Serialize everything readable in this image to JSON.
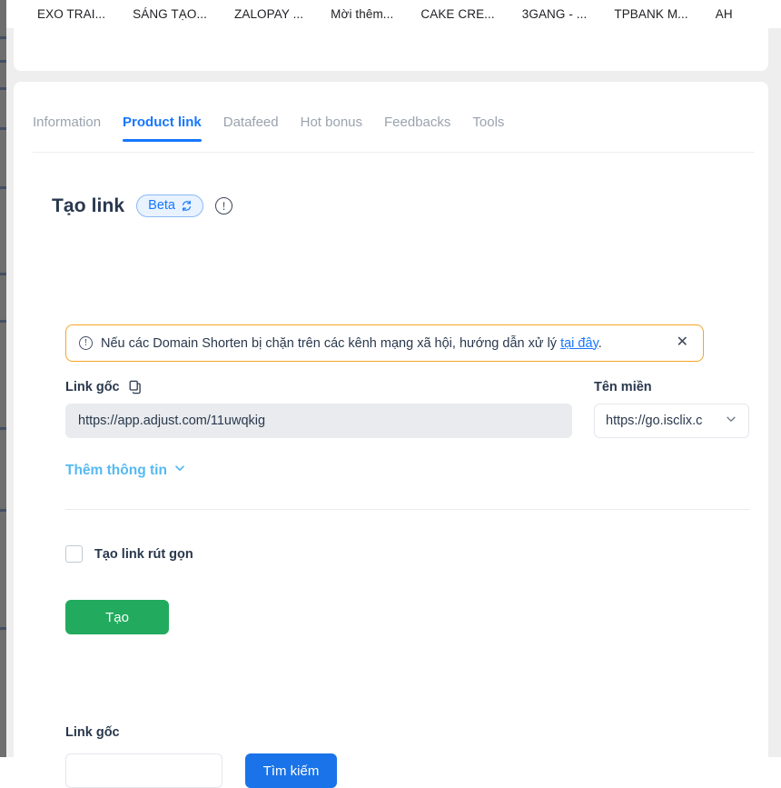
{
  "browser": {
    "bookmarks": [
      {
        "label": "EXO TRAI..."
      },
      {
        "label": "SÁNG TẠO..."
      },
      {
        "label": "ZALOPAY ..."
      },
      {
        "label": "Mời thêm..."
      },
      {
        "label": "CAKE CRE..."
      },
      {
        "label": "3GANG - ..."
      },
      {
        "label": "TPBANK M..."
      },
      {
        "label": "AH"
      }
    ]
  },
  "tabs": [
    {
      "label": "Information",
      "active": false
    },
    {
      "label": "Product link",
      "active": true
    },
    {
      "label": "Datafeed",
      "active": false
    },
    {
      "label": "Hot bonus",
      "active": false
    },
    {
      "label": "Feedbacks",
      "active": false
    },
    {
      "label": "Tools",
      "active": false
    }
  ],
  "section": {
    "title": "Tạo link",
    "beta_label": "Beta",
    "info_icon_glyph": "!"
  },
  "alert": {
    "icon_glyph": "!",
    "text_before": "Nếu các Domain Shorten bị chặn trên các kênh mạng xã hội, hướng dẫn xử lý ",
    "link_text": "tại đây",
    "text_after": ".",
    "close_glyph": "✕",
    "border_color": "#f5a524"
  },
  "form": {
    "orig_link_label": "Link gốc",
    "orig_link_value": "https://app.adjust.com/11uwqkig",
    "orig_link_placeholder": "",
    "domain_label": "Tên miền",
    "domain_selected": "https://go.isclix.c",
    "more_info_label": "Thêm thông tin",
    "shorten_checkbox_label": "Tạo link rút gọn",
    "shorten_checked": false,
    "create_button_label": "Tạo",
    "create_button_color": "#22ab5e"
  },
  "search": {
    "label": "Link gốc",
    "value": "",
    "placeholder": "",
    "button_label": "Tìm kiếm",
    "button_color": "#1a73e8"
  },
  "theme": {
    "accent_blue": "#1677ff",
    "light_blue": "#55b9f2",
    "text_dark": "#29384d",
    "muted": "#9aa3ae",
    "page_bg": "#eeeeee"
  }
}
